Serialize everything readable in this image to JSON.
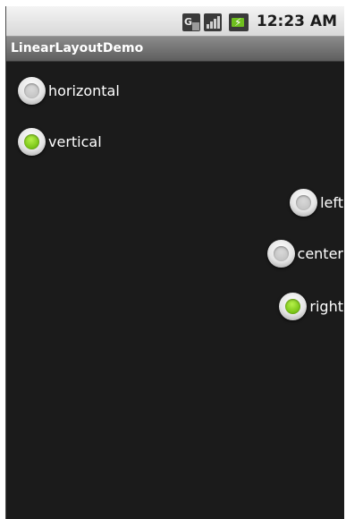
{
  "status_bar": {
    "time": "12:23 AM",
    "icons": [
      "network-type-icon",
      "signal-icon",
      "battery-charging-icon"
    ]
  },
  "title_bar": {
    "title": "LinearLayoutDemo"
  },
  "orientation_group": {
    "options": [
      {
        "label": "horizontal",
        "checked": false
      },
      {
        "label": "vertical",
        "checked": true
      }
    ]
  },
  "gravity_group": {
    "options": [
      {
        "label": "left",
        "checked": false
      },
      {
        "label": "center",
        "checked": false
      },
      {
        "label": "right",
        "checked": true
      }
    ]
  },
  "colors": {
    "background": "#1b1b1b",
    "radio_checked": "#7ec81a",
    "label_text": "#ffffff"
  }
}
